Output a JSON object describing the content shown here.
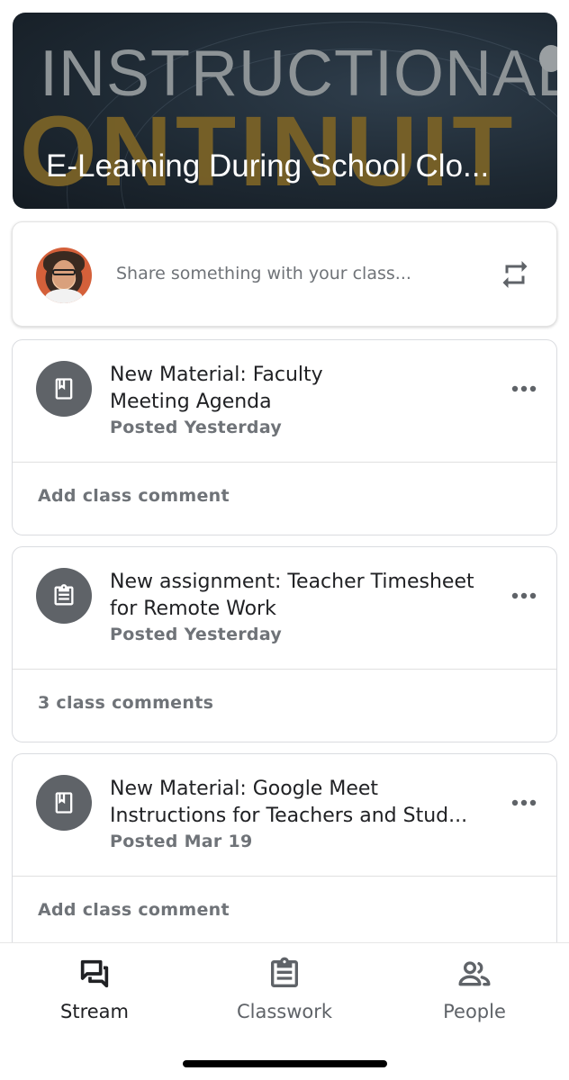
{
  "banner": {
    "background_word_top": "INSTRUCTIONAL",
    "background_word_bottom": "ONTINUIT",
    "title": "E-Learning During School Clo..."
  },
  "composer": {
    "placeholder": "Share something with your class..."
  },
  "posts": [
    {
      "type": "material",
      "icon": "book-icon",
      "title_line1": "New Material: Faculty",
      "title_line2": "Meeting Agenda",
      "date": "Posted Yesterday",
      "comment_text": "Add class comment"
    },
    {
      "type": "assignment",
      "icon": "assignment-icon",
      "title_line1": "New assignment: Teacher Timesheet",
      "title_line2": "for Remote Work",
      "date": "Posted Yesterday",
      "comment_text": "3 class comments"
    },
    {
      "type": "material",
      "icon": "book-icon",
      "title_line1": "New Material: Google Meet",
      "title_line2": "Instructions for Teachers and Stud...",
      "date": "Posted Mar 19",
      "comment_text": "Add class comment"
    }
  ],
  "nav": {
    "items": [
      {
        "label": "Stream",
        "icon": "stream-icon",
        "active": true
      },
      {
        "label": "Classwork",
        "icon": "classwork-icon",
        "active": false
      },
      {
        "label": "People",
        "icon": "people-icon",
        "active": false
      }
    ]
  },
  "colors": {
    "icon_circle": "#5f6368",
    "text_primary": "#202124",
    "text_secondary": "#6f7378",
    "banner_gold": "#7a6227"
  }
}
